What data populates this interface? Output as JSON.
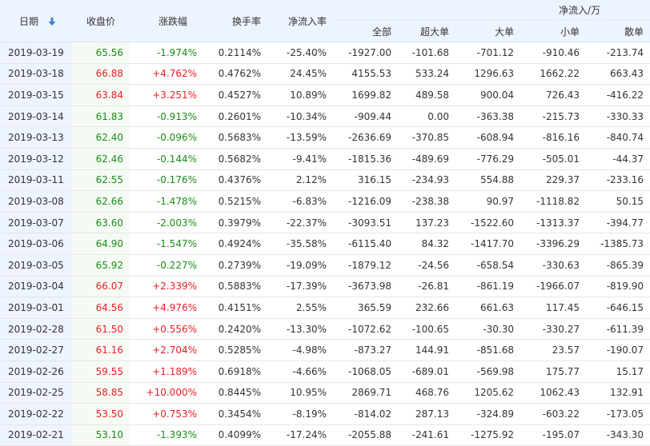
{
  "headers": {
    "date": "日期",
    "close": "收盘价",
    "change": "涨跌幅",
    "turnover": "换手率",
    "net_rate": "净流入率",
    "net_group": "净流入/万",
    "total": "全部",
    "super_large": "超大单",
    "large": "大单",
    "small": "小单",
    "retail": "散单"
  },
  "colors": {
    "up": "#ee1d24",
    "down": "#1b8c1b",
    "header_bg": "#edf4fd",
    "sort_icon": "#3d7fd1"
  },
  "sort_icon": "arrow-down-icon",
  "rows": [
    {
      "date": "2019-03-19",
      "close": "65.56",
      "change": "-1.974%",
      "turnover": "0.2114%",
      "net_rate": "-25.40%",
      "total": "-1927.00",
      "super_large": "-101.68",
      "large": "-701.12",
      "small": "-910.46",
      "retail": "-213.74",
      "dir": "down"
    },
    {
      "date": "2019-03-18",
      "close": "66.88",
      "change": "+4.762%",
      "turnover": "0.4762%",
      "net_rate": "24.45%",
      "total": "4155.53",
      "super_large": "533.24",
      "large": "1296.63",
      "small": "1662.22",
      "retail": "663.43",
      "dir": "up"
    },
    {
      "date": "2019-03-15",
      "close": "63.84",
      "change": "+3.251%",
      "turnover": "0.4527%",
      "net_rate": "10.89%",
      "total": "1699.82",
      "super_large": "489.58",
      "large": "900.04",
      "small": "726.43",
      "retail": "-416.22",
      "dir": "up"
    },
    {
      "date": "2019-03-14",
      "close": "61.83",
      "change": "-0.913%",
      "turnover": "0.2601%",
      "net_rate": "-10.34%",
      "total": "-909.44",
      "super_large": "0.00",
      "large": "-363.38",
      "small": "-215.73",
      "retail": "-330.33",
      "dir": "down"
    },
    {
      "date": "2019-03-13",
      "close": "62.40",
      "change": "-0.096%",
      "turnover": "0.5683%",
      "net_rate": "-13.59%",
      "total": "-2636.69",
      "super_large": "-370.85",
      "large": "-608.94",
      "small": "-816.16",
      "retail": "-840.74",
      "dir": "down"
    },
    {
      "date": "2019-03-12",
      "close": "62.46",
      "change": "-0.144%",
      "turnover": "0.5682%",
      "net_rate": "-9.41%",
      "total": "-1815.36",
      "super_large": "-489.69",
      "large": "-776.29",
      "small": "-505.01",
      "retail": "-44.37",
      "dir": "down"
    },
    {
      "date": "2019-03-11",
      "close": "62.55",
      "change": "-0.176%",
      "turnover": "0.4376%",
      "net_rate": "2.12%",
      "total": "316.15",
      "super_large": "-234.93",
      "large": "554.88",
      "small": "229.37",
      "retail": "-233.16",
      "dir": "down"
    },
    {
      "date": "2019-03-08",
      "close": "62.66",
      "change": "-1.478%",
      "turnover": "0.5215%",
      "net_rate": "-6.83%",
      "total": "-1216.09",
      "super_large": "-238.38",
      "large": "90.97",
      "small": "-1118.82",
      "retail": "50.15",
      "dir": "down"
    },
    {
      "date": "2019-03-07",
      "close": "63.60",
      "change": "-2.003%",
      "turnover": "0.3979%",
      "net_rate": "-22.37%",
      "total": "-3093.51",
      "super_large": "137.23",
      "large": "-1522.60",
      "small": "-1313.37",
      "retail": "-394.77",
      "dir": "down"
    },
    {
      "date": "2019-03-06",
      "close": "64.90",
      "change": "-1.547%",
      "turnover": "0.4924%",
      "net_rate": "-35.58%",
      "total": "-6115.40",
      "super_large": "84.32",
      "large": "-1417.70",
      "small": "-3396.29",
      "retail": "-1385.73",
      "dir": "down"
    },
    {
      "date": "2019-03-05",
      "close": "65.92",
      "change": "-0.227%",
      "turnover": "0.2739%",
      "net_rate": "-19.09%",
      "total": "-1879.12",
      "super_large": "-24.56",
      "large": "-658.54",
      "small": "-330.63",
      "retail": "-865.39",
      "dir": "down"
    },
    {
      "date": "2019-03-04",
      "close": "66.07",
      "change": "+2.339%",
      "turnover": "0.5883%",
      "net_rate": "-17.39%",
      "total": "-3673.98",
      "super_large": "-26.81",
      "large": "-861.19",
      "small": "-1966.07",
      "retail": "-819.90",
      "dir": "up"
    },
    {
      "date": "2019-03-01",
      "close": "64.56",
      "change": "+4.976%",
      "turnover": "0.4151%",
      "net_rate": "2.55%",
      "total": "365.59",
      "super_large": "232.66",
      "large": "661.63",
      "small": "117.45",
      "retail": "-646.15",
      "dir": "up"
    },
    {
      "date": "2019-02-28",
      "close": "61.50",
      "change": "+0.556%",
      "turnover": "0.2420%",
      "net_rate": "-13.30%",
      "total": "-1072.62",
      "super_large": "-100.65",
      "large": "-30.30",
      "small": "-330.27",
      "retail": "-611.39",
      "dir": "up"
    },
    {
      "date": "2019-02-27",
      "close": "61.16",
      "change": "+2.704%",
      "turnover": "0.5285%",
      "net_rate": "-4.98%",
      "total": "-873.27",
      "super_large": "144.91",
      "large": "-851.68",
      "small": "23.57",
      "retail": "-190.07",
      "dir": "up"
    },
    {
      "date": "2019-02-26",
      "close": "59.55",
      "change": "+1.189%",
      "turnover": "0.6918%",
      "net_rate": "-4.66%",
      "total": "-1068.05",
      "super_large": "-689.01",
      "large": "-569.98",
      "small": "175.77",
      "retail": "15.17",
      "dir": "up"
    },
    {
      "date": "2019-02-25",
      "close": "58.85",
      "change": "+10.000%",
      "turnover": "0.8445%",
      "net_rate": "10.95%",
      "total": "2869.71",
      "super_large": "468.76",
      "large": "1205.62",
      "small": "1062.43",
      "retail": "132.91",
      "dir": "up"
    },
    {
      "date": "2019-02-22",
      "close": "53.50",
      "change": "+0.753%",
      "turnover": "0.3454%",
      "net_rate": "-8.19%",
      "total": "-814.02",
      "super_large": "287.13",
      "large": "-324.89",
      "small": "-603.22",
      "retail": "-173.05",
      "dir": "up"
    },
    {
      "date": "2019-02-21",
      "close": "53.10",
      "change": "-1.393%",
      "turnover": "0.4099%",
      "net_rate": "-17.24%",
      "total": "-2055.88",
      "super_large": "-241.61",
      "large": "-1275.92",
      "small": "-195.07",
      "retail": "-343.30",
      "dir": "down"
    }
  ]
}
